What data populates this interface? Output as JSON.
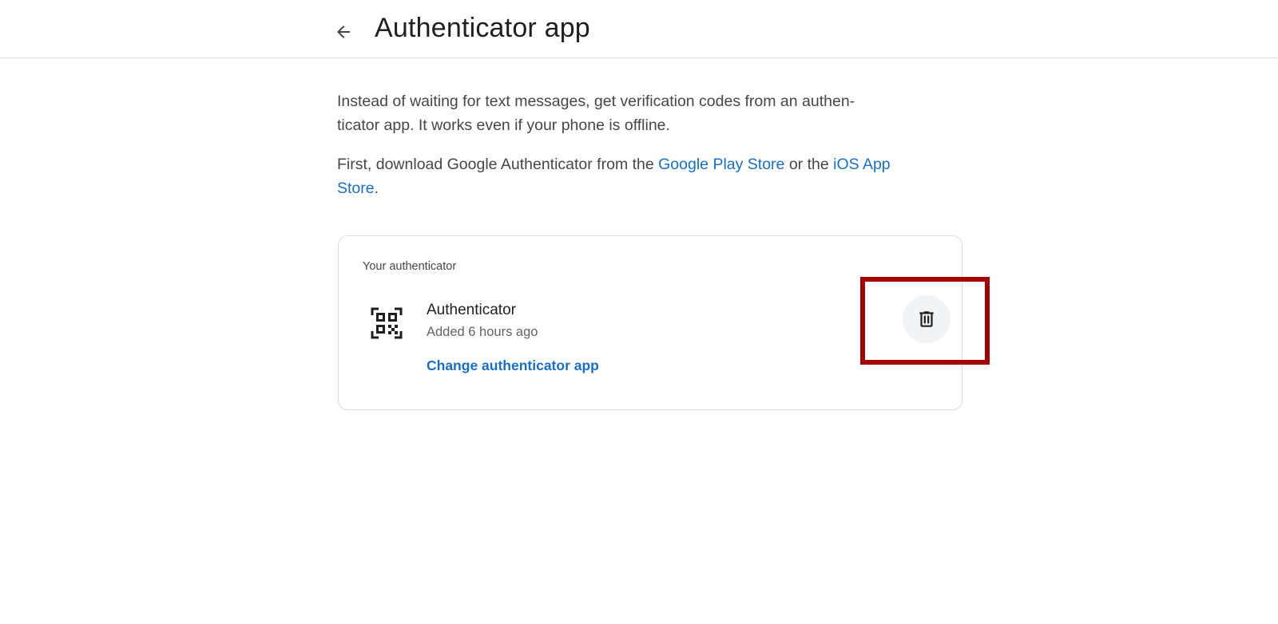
{
  "header": {
    "title": "Authenticator app",
    "back_icon": "arrow-left-icon"
  },
  "intro": {
    "paragraph1": "Instead of waiting for text messages, get verification codes from an authen- ticator app. It works even if your phone is offline.",
    "paragraph2_prefix": "First, download Google Authenticator from the ",
    "play_store_link": "Google Play Store",
    "paragraph2_middle": " or the ",
    "ios_store_link": "iOS App Store",
    "paragraph2_suffix": "."
  },
  "card": {
    "heading": "Your authenticator",
    "app_icon": "qr-code-icon",
    "app_name": "Authenticator",
    "added": "Added 6 hours ago",
    "change_link": "Change authenticator app",
    "delete_icon": "trash-icon"
  },
  "colors": {
    "link": "#1a6fc2",
    "highlight": "#a50000",
    "divider": "#dadce0"
  }
}
